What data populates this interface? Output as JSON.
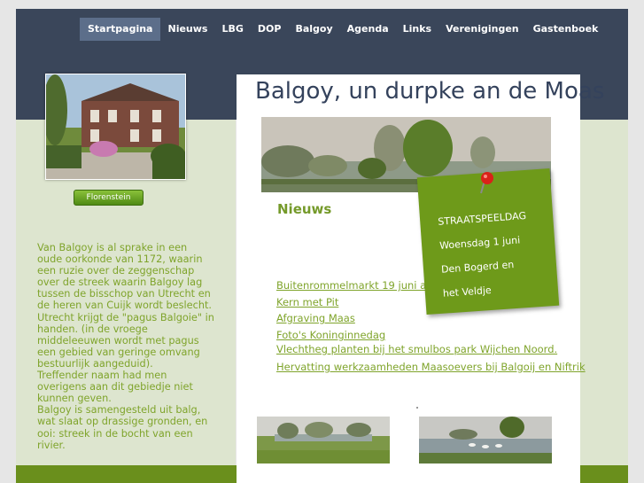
{
  "nav": {
    "items": [
      "Startpagina",
      "Nieuws",
      "LBG",
      "DOP",
      "Balgoy",
      "Agenda",
      "Links",
      "Verenigingen",
      "Gastenboek"
    ],
    "active": "Startpagina"
  },
  "sidebar": {
    "photo_button": "Florenstein",
    "intro_lines": [
      "Van Balgoy is al sprake in een",
      "oude oorkonde van 1172, waarin",
      "een ruzie over de zeggenschap",
      "over de streek waarin Balgoy lag",
      "tussen de bisschop van Utrecht en",
      "de heren van Cuijk wordt beslecht.",
      "Utrecht krijgt de \"pagus Balgoie\" in",
      "handen. (in de vroege",
      "middeleeuwen wordt met pagus",
      "een gebied van geringe omvang",
      "bestuurlijk aangeduid).",
      "Treffender naam had men",
      "overigens aan dit gebiedje niet",
      "kunnen geven.",
      "Balgoy is samengesteld uit balg,",
      "wat slaat op drassige gronden, en",
      "ooi: streek in de bocht van een",
      "rivier."
    ]
  },
  "main": {
    "title": "Balgoy, un durpke an de Moas",
    "news_heading": "Nieuws",
    "news_links": [
      "Buitenrommelmarkt 19 juni a.s.",
      "Kern met Pit",
      "Afgraving Maas",
      "Foto's Koninginnedag",
      "Vlechtheg planten bij het smulbos park Wijchen Noord.",
      "Hervatting werkzaamheden Maasoevers bij Balgoij en Niftrik"
    ],
    "sticky": [
      "STRAATSPEELDAG",
      "Woensdag 1 juni",
      "Den Bogerd en",
      "het Veldje"
    ]
  },
  "colors": {
    "header": "#3a465a",
    "nav_active": "#5c6e8a",
    "accent_green": "#7fa42b",
    "sticky_green": "#6e9a1a",
    "side_bg": "#dde5cf",
    "title": "#34425c"
  }
}
